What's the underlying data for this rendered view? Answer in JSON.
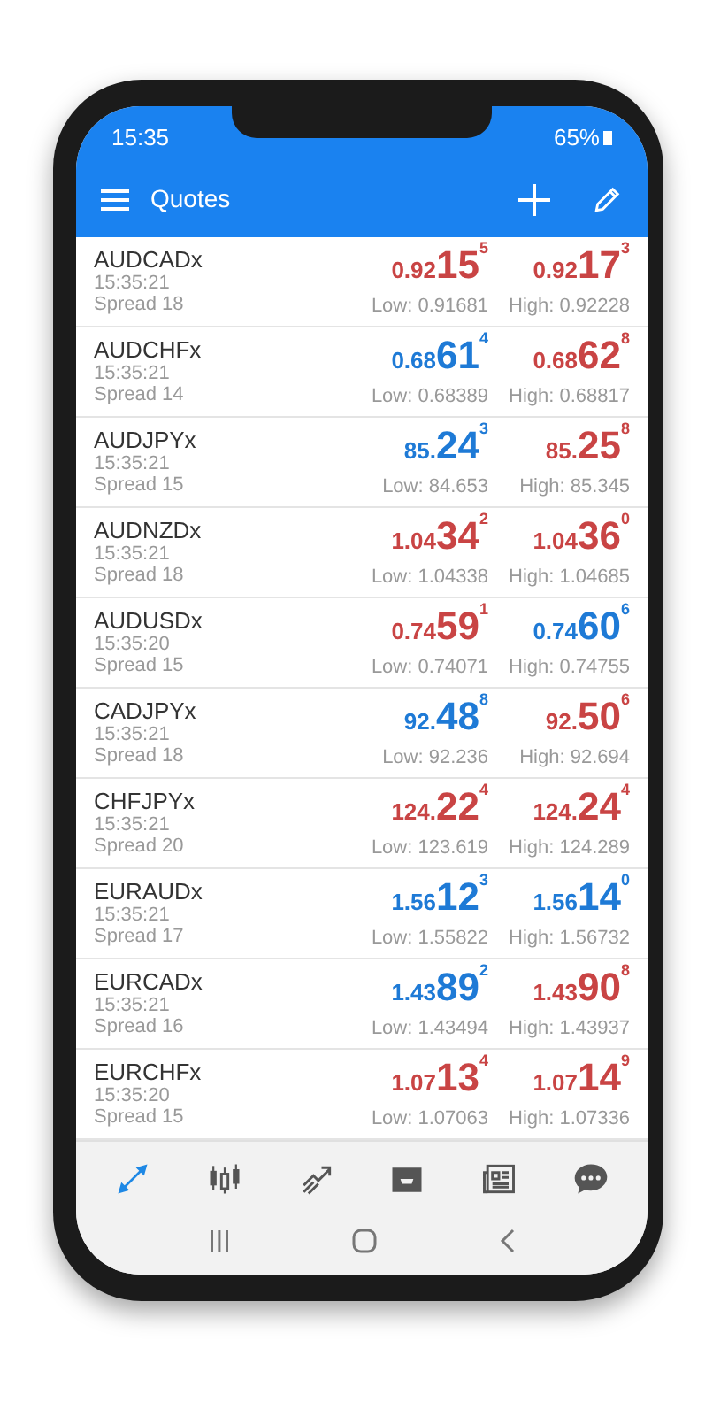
{
  "status_bar": {
    "time": "15:35",
    "battery": "65%"
  },
  "toolbar": {
    "title": "Quotes"
  },
  "quotes": [
    {
      "symbol": "AUDCADx",
      "time": "15:35:21",
      "spread": "Spread 18",
      "bid": {
        "prefix": "0.92",
        "big": "15",
        "sup": "5",
        "color": "#c94444"
      },
      "ask": {
        "prefix": "0.92",
        "big": "17",
        "sup": "3",
        "color": "#c94444"
      },
      "low": "Low: 0.91681",
      "high": "High: 0.92228"
    },
    {
      "symbol": "AUDCHFx",
      "time": "15:35:21",
      "spread": "Spread 14",
      "bid": {
        "prefix": "0.68",
        "big": "61",
        "sup": "4",
        "color": "#1e7ad6"
      },
      "ask": {
        "prefix": "0.68",
        "big": "62",
        "sup": "8",
        "color": "#c94444"
      },
      "low": "Low: 0.68389",
      "high": "High: 0.68817"
    },
    {
      "symbol": "AUDJPYx",
      "time": "15:35:21",
      "spread": "Spread 15",
      "bid": {
        "prefix": "85.",
        "big": "24",
        "sup": "3",
        "color": "#1e7ad6"
      },
      "ask": {
        "prefix": "85.",
        "big": "25",
        "sup": "8",
        "color": "#c94444"
      },
      "low": "Low: 84.653",
      "high": "High: 85.345"
    },
    {
      "symbol": "AUDNZDx",
      "time": "15:35:21",
      "spread": "Spread 18",
      "bid": {
        "prefix": "1.04",
        "big": "34",
        "sup": "2",
        "color": "#c94444"
      },
      "ask": {
        "prefix": "1.04",
        "big": "36",
        "sup": "0",
        "color": "#c94444"
      },
      "low": "Low: 1.04338",
      "high": "High: 1.04685"
    },
    {
      "symbol": "AUDUSDx",
      "time": "15:35:20",
      "spread": "Spread 15",
      "bid": {
        "prefix": "0.74",
        "big": "59",
        "sup": "1",
        "color": "#c94444"
      },
      "ask": {
        "prefix": "0.74",
        "big": "60",
        "sup": "6",
        "color": "#1e7ad6"
      },
      "low": "Low: 0.74071",
      "high": "High: 0.74755"
    },
    {
      "symbol": "CADJPYx",
      "time": "15:35:21",
      "spread": "Spread 18",
      "bid": {
        "prefix": "92.",
        "big": "48",
        "sup": "8",
        "color": "#1e7ad6"
      },
      "ask": {
        "prefix": "92.",
        "big": "50",
        "sup": "6",
        "color": "#c94444"
      },
      "low": "Low: 92.236",
      "high": "High: 92.694"
    },
    {
      "symbol": "CHFJPYx",
      "time": "15:35:21",
      "spread": "Spread 20",
      "bid": {
        "prefix": "124.",
        "big": "22",
        "sup": "4",
        "color": "#c94444"
      },
      "ask": {
        "prefix": "124.",
        "big": "24",
        "sup": "4",
        "color": "#c94444"
      },
      "low": "Low: 123.619",
      "high": "High: 124.289"
    },
    {
      "symbol": "EURAUDx",
      "time": "15:35:21",
      "spread": "Spread 17",
      "bid": {
        "prefix": "1.56",
        "big": "12",
        "sup": "3",
        "color": "#1e7ad6"
      },
      "ask": {
        "prefix": "1.56",
        "big": "14",
        "sup": "0",
        "color": "#1e7ad6"
      },
      "low": "Low: 1.55822",
      "high": "High: 1.56732"
    },
    {
      "symbol": "EURCADx",
      "time": "15:35:21",
      "spread": "Spread 16",
      "bid": {
        "prefix": "1.43",
        "big": "89",
        "sup": "2",
        "color": "#1e7ad6"
      },
      "ask": {
        "prefix": "1.43",
        "big": "90",
        "sup": "8",
        "color": "#c94444"
      },
      "low": "Low: 1.43494",
      "high": "High: 1.43937"
    },
    {
      "symbol": "EURCHFx",
      "time": "15:35:20",
      "spread": "Spread 15",
      "bid": {
        "prefix": "1.07",
        "big": "13",
        "sup": "4",
        "color": "#c94444"
      },
      "ask": {
        "prefix": "1.07",
        "big": "14",
        "sup": "9",
        "color": "#c94444"
      },
      "low": "Low: 1.07063",
      "high": "High: 1.07336"
    }
  ],
  "bottom_nav": [
    {
      "kind": "quotes",
      "selected": true
    },
    {
      "kind": "chart",
      "selected": false
    },
    {
      "kind": "trade",
      "selected": false
    },
    {
      "kind": "history",
      "selected": false
    },
    {
      "kind": "news",
      "selected": false
    },
    {
      "kind": "chat",
      "selected": false
    }
  ]
}
